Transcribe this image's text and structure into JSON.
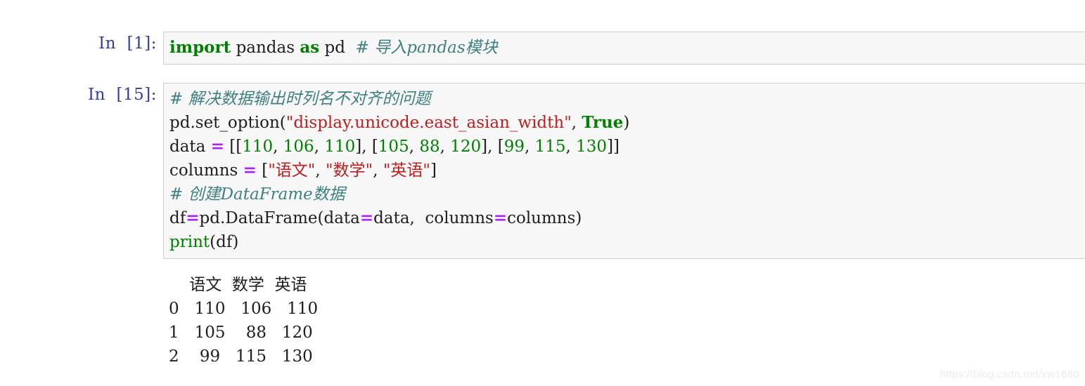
{
  "notebook": {
    "cells": [
      {
        "prompt": "In  [1]:",
        "lines": [
          [
            {
              "t": "import",
              "c": "kw"
            },
            {
              "t": " ",
              "c": "plain"
            },
            {
              "t": "pandas",
              "c": "name"
            },
            {
              "t": " ",
              "c": "plain"
            },
            {
              "t": "as",
              "c": "kw"
            },
            {
              "t": " ",
              "c": "plain"
            },
            {
              "t": "pd",
              "c": "name"
            },
            {
              "t": "  ",
              "c": "plain"
            },
            {
              "t": "# 导入pandas模块",
              "c": "comment"
            }
          ]
        ]
      },
      {
        "prompt": "In  [15]:",
        "lines": [
          [
            {
              "t": "# 解决数据输出时列名不对齐的问题",
              "c": "comment"
            }
          ],
          [
            {
              "t": "pd",
              "c": "name"
            },
            {
              "t": ".",
              "c": "punct"
            },
            {
              "t": "set_option",
              "c": "name"
            },
            {
              "t": "(",
              "c": "punct"
            },
            {
              "t": "\"display.unicode.east_asian_width\"",
              "c": "str"
            },
            {
              "t": ", ",
              "c": "punct"
            },
            {
              "t": "True",
              "c": "kw"
            },
            {
              "t": ")",
              "c": "punct"
            }
          ],
          [
            {
              "t": "data ",
              "c": "name"
            },
            {
              "t": "=",
              "c": "op"
            },
            {
              "t": " ",
              "c": "plain"
            },
            {
              "t": "[[",
              "c": "punct"
            },
            {
              "t": "110",
              "c": "num"
            },
            {
              "t": ", ",
              "c": "punct"
            },
            {
              "t": "106",
              "c": "num"
            },
            {
              "t": ", ",
              "c": "punct"
            },
            {
              "t": "110",
              "c": "num"
            },
            {
              "t": "], [",
              "c": "punct"
            },
            {
              "t": "105",
              "c": "num"
            },
            {
              "t": ", ",
              "c": "punct"
            },
            {
              "t": "88",
              "c": "num"
            },
            {
              "t": ", ",
              "c": "punct"
            },
            {
              "t": "120",
              "c": "num"
            },
            {
              "t": "], [",
              "c": "punct"
            },
            {
              "t": "99",
              "c": "num"
            },
            {
              "t": ", ",
              "c": "punct"
            },
            {
              "t": "115",
              "c": "num"
            },
            {
              "t": ", ",
              "c": "punct"
            },
            {
              "t": "130",
              "c": "num"
            },
            {
              "t": "]]",
              "c": "punct"
            }
          ],
          [
            {
              "t": "columns ",
              "c": "name"
            },
            {
              "t": "=",
              "c": "op"
            },
            {
              "t": " ",
              "c": "plain"
            },
            {
              "t": "[",
              "c": "punct"
            },
            {
              "t": "\"语文\"",
              "c": "str"
            },
            {
              "t": ", ",
              "c": "punct"
            },
            {
              "t": "\"数学\"",
              "c": "str"
            },
            {
              "t": ", ",
              "c": "punct"
            },
            {
              "t": "\"英语\"",
              "c": "str"
            },
            {
              "t": "]",
              "c": "punct"
            }
          ],
          [
            {
              "t": "# 创建DataFrame数据",
              "c": "comment"
            }
          ],
          [
            {
              "t": "df",
              "c": "name"
            },
            {
              "t": "=",
              "c": "op"
            },
            {
              "t": "pd",
              "c": "name"
            },
            {
              "t": ".",
              "c": "punct"
            },
            {
              "t": "DataFrame",
              "c": "name"
            },
            {
              "t": "(",
              "c": "punct"
            },
            {
              "t": "data",
              "c": "name"
            },
            {
              "t": "=",
              "c": "op"
            },
            {
              "t": "data",
              "c": "name"
            },
            {
              "t": ",  ",
              "c": "punct"
            },
            {
              "t": "columns",
              "c": "name"
            },
            {
              "t": "=",
              "c": "op"
            },
            {
              "t": "columns",
              "c": "name"
            },
            {
              "t": ")",
              "c": "punct"
            }
          ],
          [
            {
              "t": "print",
              "c": "builtin"
            },
            {
              "t": "(",
              "c": "punct"
            },
            {
              "t": "df",
              "c": "name"
            },
            {
              "t": ")",
              "c": "punct"
            }
          ]
        ],
        "output": {
          "type": "text",
          "lines": [
            "    语文  数学  英语",
            "0   110   106   110",
            "1   105    88   120",
            "2    99   115   130"
          ],
          "table": {
            "index_name": "",
            "columns": [
              "语文",
              "数学",
              "英语"
            ],
            "index": [
              "0",
              "1",
              "2"
            ],
            "rows": [
              [
                "110",
                "106",
                "110"
              ],
              [
                "105",
                "88",
                "120"
              ],
              [
                "99",
                "115",
                "130"
              ]
            ]
          }
        }
      }
    ]
  },
  "watermark": "https://blog.csdn.net/xw1680",
  "colors": {
    "prompt": "#303F9F",
    "cell_bg": "#F7F7F7",
    "cell_border": "#CFCFCF",
    "keyword": "#008000",
    "string": "#BA2121",
    "number": "#008000",
    "operator": "#AA22FF",
    "comment": "#408080",
    "text": "#202020",
    "watermark": "#EBEBEB"
  }
}
